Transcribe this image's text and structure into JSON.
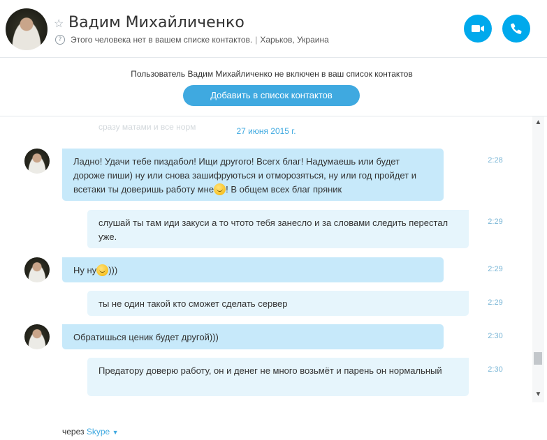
{
  "header": {
    "contact_name": "Вадим Михайличенко",
    "status": "Этого человека нет в вашем списке контактов.",
    "location": "Харьков, Украина"
  },
  "notice": {
    "text": "Пользователь Вадим Михайличенко не включен в ваш список контактов",
    "add_button": "Добавить в список контактов"
  },
  "chat": {
    "faded_text": "сразу матами и все норм",
    "date": "27 июня 2015 г.",
    "messages": [
      {
        "direction": "in",
        "part1": "Ладно! Удачи тебе пиздабол! Ищи другого! Всегх благ! Надумаешь или будет дороже пиши) ну или снова зашифруються и отморозяться, ну или год пройдет и всетаки ты доверишь работу мне",
        "part2": "! В общем всех благ пряник",
        "time": "2:28"
      },
      {
        "direction": "out",
        "text": "слушай ты там иди закуси а то чтото тебя занесло и за словами следить перестал уже.",
        "time": "2:29"
      },
      {
        "direction": "in",
        "part1": "Ну ну",
        "part2": ")))",
        "time": "2:29"
      },
      {
        "direction": "out",
        "text": "ты не один такой кто сможет сделать сервер",
        "time": "2:29"
      },
      {
        "direction": "in",
        "text": "Обратишься ценик будет другой)))",
        "time": "2:30"
      },
      {
        "direction": "out",
        "text": "Предатору доверю работу, он и денег не много возьмёт и парень он нормальный",
        "time": "2:30"
      }
    ]
  },
  "footer": {
    "via": "через",
    "service": "Skype"
  },
  "colors": {
    "accent": "#00a9ec",
    "incoming_bubble": "#c7e9fa",
    "outgoing_bubble": "#e6f5fc"
  }
}
